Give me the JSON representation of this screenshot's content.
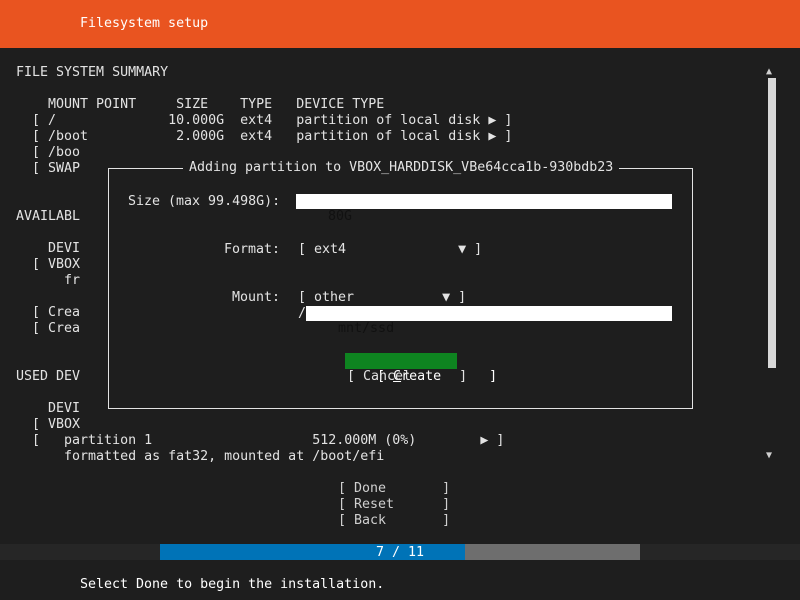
{
  "header": {
    "title": "Filesystem setup"
  },
  "summary": {
    "heading": "FILE SYSTEM SUMMARY",
    "columns": "    MOUNT POINT     SIZE    TYPE   DEVICE TYPE",
    "rows": [
      "  [ /              10.000G  ext4   partition of local disk ▶ ]",
      "  [ /boot           2.000G  ext4   partition of local disk ▶ ]",
      "  [ /boo",
      "  [ SWAP"
    ]
  },
  "available": {
    "heading": "AVAILABL",
    "lines": [
      "    DEVI",
      "  [ VBOX",
      "      fr",
      "  [ Crea",
      "  [ Crea"
    ]
  },
  "used": {
    "heading": "USED DEV",
    "lines": [
      "    DEVI",
      "  [ VBOX",
      "  [   partition 1                    512.000M (0%)        ▶ ]",
      "      formatted as fat32, mounted at /boot/efi"
    ]
  },
  "dialog": {
    "title": "Adding partition to VBOX_HARDDISK_VBe64cca1b-930bdb23",
    "size_label": "Size (max 99.498G):",
    "size_value": "80G",
    "format_label": "Format:",
    "format_value": "[ ext4              ▼ ]",
    "mount_label": "Mount:",
    "mount_value": "[ other           ▼ ]",
    "mount_prefix": "/",
    "mount_path": "mnt/ssd",
    "create_open": "[ ",
    "create_hotkey": "C",
    "create_rest": "reate      ]",
    "cancel_label": "[ Cancel      ]"
  },
  "actions": {
    "done": "[ Done       ]",
    "reset": "[ Reset      ]",
    "back": "[ Back       ]"
  },
  "progress": {
    "text": "7 / 11",
    "current": 7,
    "total": 11
  },
  "footer": {
    "hint": "Select Done to begin the installation."
  },
  "icons": {
    "scroll_up": "▲",
    "scroll_down": "▼"
  },
  "colors": {
    "header": "#e95420",
    "accent_button": "#0e8420",
    "progress": "#0073b7"
  }
}
